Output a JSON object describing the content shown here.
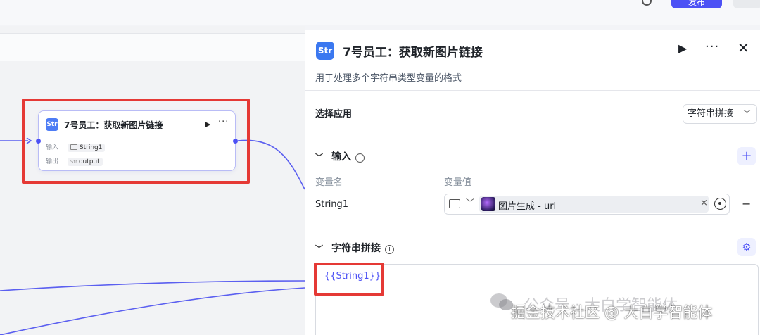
{
  "topbar": {
    "primary_button": "发布"
  },
  "node": {
    "title": "7号员工：获取新图片链接",
    "input_label": "输入",
    "input_tag": "String1",
    "output_label": "输出",
    "output_tag_prefix": "Str",
    "output_tag": "output"
  },
  "panel": {
    "title": "7号员工：获取新图片链接",
    "description": "用于处理多个字符串类型变量的格式",
    "select_app_label": "选择应用",
    "select_app_value": "字符串拼接",
    "input_section": "输入",
    "col_var_name": "变量名",
    "col_var_value": "变量值",
    "var_name": "String1",
    "var_ref": "图片生成 - url",
    "concat_section": "字符串拼接",
    "editor_text": "{{String1}}"
  },
  "watermark": {
    "line1": "公众号 · 大白学智能体",
    "line2": "掘金技术社区 @ 大白学智能体"
  },
  "colors": {
    "accent": "#4c51f5",
    "highlight": "#e53935",
    "node_icon": "#3b78f0"
  }
}
